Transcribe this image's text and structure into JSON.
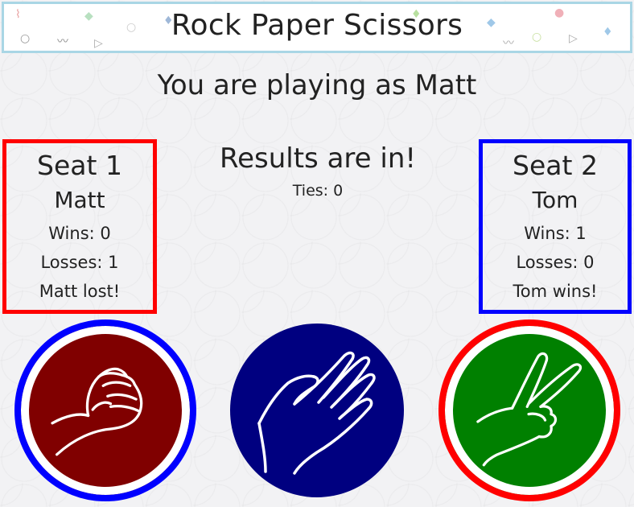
{
  "header": {
    "title": "Rock Paper Scissors"
  },
  "playing_as": "You are playing as Matt",
  "seat1": {
    "title": "Seat 1",
    "name": "Matt",
    "wins": "Wins: 0",
    "losses": "Losses: 1",
    "outcome": "Matt lost!",
    "border_color": "#ff0000"
  },
  "seat2": {
    "title": "Seat 2",
    "name": "Tom",
    "wins": "Wins: 1",
    "losses": "Losses: 0",
    "outcome": "Tom wins!",
    "border_color": "#0000ff"
  },
  "results": {
    "title": "Results are in!",
    "ties": "Ties: 0"
  },
  "choices": [
    {
      "icon": "rock-hand-icon",
      "color": "#800000",
      "ring": "#0000ff"
    },
    {
      "icon": "paper-hand-icon",
      "color": "#000080"
    },
    {
      "icon": "scissors-hand-icon",
      "color": "#008000",
      "ring": "#ff0000"
    }
  ]
}
